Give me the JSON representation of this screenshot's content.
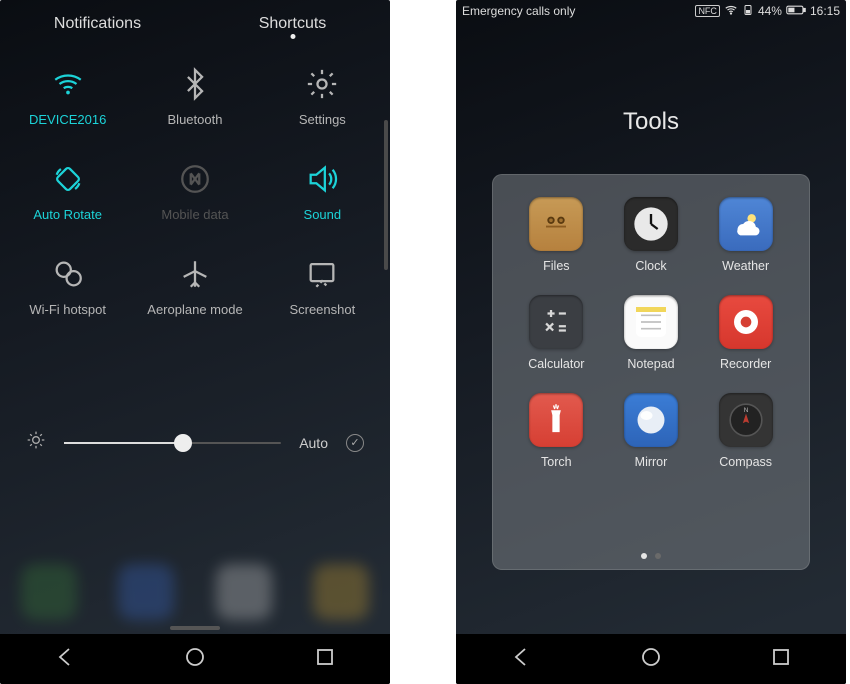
{
  "left": {
    "tabs": {
      "notifications": "Notifications",
      "shortcuts": "Shortcuts"
    },
    "tiles": [
      {
        "key": "wifi",
        "label": "DEVICE2016",
        "active": true,
        "dim": false
      },
      {
        "key": "bluetooth",
        "label": "Bluetooth",
        "active": false,
        "dim": false
      },
      {
        "key": "settings",
        "label": "Settings",
        "active": false,
        "dim": false
      },
      {
        "key": "rotate",
        "label": "Auto Rotate",
        "active": true,
        "dim": false
      },
      {
        "key": "mobiledata",
        "label": "Mobile data",
        "active": false,
        "dim": true
      },
      {
        "key": "sound",
        "label": "Sound",
        "active": true,
        "dim": false
      },
      {
        "key": "hotspot",
        "label": "Wi-Fi hotspot",
        "active": false,
        "dim": false
      },
      {
        "key": "airplane",
        "label": "Aeroplane mode",
        "active": false,
        "dim": false
      },
      {
        "key": "screenshot",
        "label": "Screenshot",
        "active": false,
        "dim": false
      }
    ],
    "brightness": {
      "auto_label": "Auto",
      "percent": 55
    }
  },
  "right": {
    "statusbar": {
      "emergency": "Emergency calls only",
      "nfc": "NFC",
      "battery_pct": "44%",
      "time": "16:15"
    },
    "folder_title": "Tools",
    "apps": [
      {
        "key": "files",
        "name": "Files"
      },
      {
        "key": "clock",
        "name": "Clock"
      },
      {
        "key": "weather",
        "name": "Weather"
      },
      {
        "key": "calc",
        "name": "Calculator"
      },
      {
        "key": "notepad",
        "name": "Notepad"
      },
      {
        "key": "recorder",
        "name": "Recorder"
      },
      {
        "key": "torch",
        "name": "Torch"
      },
      {
        "key": "mirror",
        "name": "Mirror"
      },
      {
        "key": "compass",
        "name": "Compass"
      }
    ]
  }
}
